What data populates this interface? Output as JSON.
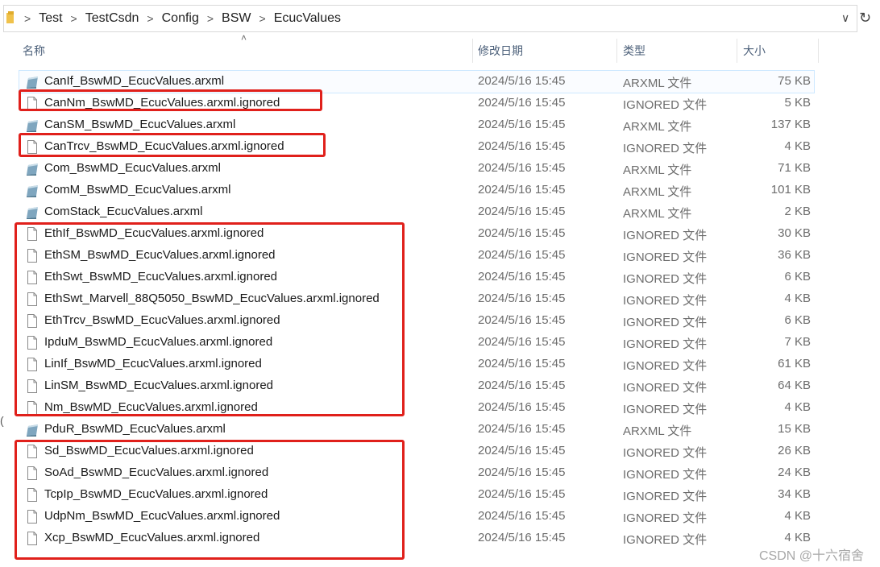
{
  "breadcrumb": [
    "Test",
    "TestCsdn",
    "Config",
    "BSW",
    "EcucValues"
  ],
  "columns": {
    "name": "名称",
    "date": "修改日期",
    "type": "类型",
    "size": "大小"
  },
  "files": [
    {
      "name": "CanIf_BswMD_EcucValues.arxml",
      "date": "2024/5/16 15:45",
      "type": "ARXML 文件",
      "size": "75 KB",
      "kind": "arxml",
      "selected": true
    },
    {
      "name": "CanNm_BswMD_EcucValues.arxml.ignored",
      "date": "2024/5/16 15:45",
      "type": "IGNORED 文件",
      "size": "5 KB",
      "kind": "ignored"
    },
    {
      "name": "CanSM_BswMD_EcucValues.arxml",
      "date": "2024/5/16 15:45",
      "type": "ARXML 文件",
      "size": "137 KB",
      "kind": "arxml"
    },
    {
      "name": "CanTrcv_BswMD_EcucValues.arxml.ignored",
      "date": "2024/5/16 15:45",
      "type": "IGNORED 文件",
      "size": "4 KB",
      "kind": "ignored"
    },
    {
      "name": "Com_BswMD_EcucValues.arxml",
      "date": "2024/5/16 15:45",
      "type": "ARXML 文件",
      "size": "71 KB",
      "kind": "arxml"
    },
    {
      "name": "ComM_BswMD_EcucValues.arxml",
      "date": "2024/5/16 15:45",
      "type": "ARXML 文件",
      "size": "101 KB",
      "kind": "arxml"
    },
    {
      "name": "ComStack_EcucValues.arxml",
      "date": "2024/5/16 15:45",
      "type": "ARXML 文件",
      "size": "2 KB",
      "kind": "arxml"
    },
    {
      "name": "EthIf_BswMD_EcucValues.arxml.ignored",
      "date": "2024/5/16 15:45",
      "type": "IGNORED 文件",
      "size": "30 KB",
      "kind": "ignored"
    },
    {
      "name": "EthSM_BswMD_EcucValues.arxml.ignored",
      "date": "2024/5/16 15:45",
      "type": "IGNORED 文件",
      "size": "36 KB",
      "kind": "ignored"
    },
    {
      "name": "EthSwt_BswMD_EcucValues.arxml.ignored",
      "date": "2024/5/16 15:45",
      "type": "IGNORED 文件",
      "size": "6 KB",
      "kind": "ignored"
    },
    {
      "name": "EthSwt_Marvell_88Q5050_BswMD_EcucValues.arxml.ignored",
      "date": "2024/5/16 15:45",
      "type": "IGNORED 文件",
      "size": "4 KB",
      "kind": "ignored"
    },
    {
      "name": "EthTrcv_BswMD_EcucValues.arxml.ignored",
      "date": "2024/5/16 15:45",
      "type": "IGNORED 文件",
      "size": "6 KB",
      "kind": "ignored"
    },
    {
      "name": "IpduM_BswMD_EcucValues.arxml.ignored",
      "date": "2024/5/16 15:45",
      "type": "IGNORED 文件",
      "size": "7 KB",
      "kind": "ignored"
    },
    {
      "name": "LinIf_BswMD_EcucValues.arxml.ignored",
      "date": "2024/5/16 15:45",
      "type": "IGNORED 文件",
      "size": "61 KB",
      "kind": "ignored"
    },
    {
      "name": "LinSM_BswMD_EcucValues.arxml.ignored",
      "date": "2024/5/16 15:45",
      "type": "IGNORED 文件",
      "size": "64 KB",
      "kind": "ignored"
    },
    {
      "name": "Nm_BswMD_EcucValues.arxml.ignored",
      "date": "2024/5/16 15:45",
      "type": "IGNORED 文件",
      "size": "4 KB",
      "kind": "ignored"
    },
    {
      "name": "PduR_BswMD_EcucValues.arxml",
      "date": "2024/5/16 15:45",
      "type": "ARXML 文件",
      "size": "15 KB",
      "kind": "arxml"
    },
    {
      "name": "Sd_BswMD_EcucValues.arxml.ignored",
      "date": "2024/5/16 15:45",
      "type": "IGNORED 文件",
      "size": "26 KB",
      "kind": "ignored"
    },
    {
      "name": "SoAd_BswMD_EcucValues.arxml.ignored",
      "date": "2024/5/16 15:45",
      "type": "IGNORED 文件",
      "size": "24 KB",
      "kind": "ignored"
    },
    {
      "name": "TcpIp_BswMD_EcucValues.arxml.ignored",
      "date": "2024/5/16 15:45",
      "type": "IGNORED 文件",
      "size": "34 KB",
      "kind": "ignored"
    },
    {
      "name": "UdpNm_BswMD_EcucValues.arxml.ignored",
      "date": "2024/5/16 15:45",
      "type": "IGNORED 文件",
      "size": "4 KB",
      "kind": "ignored"
    },
    {
      "name": "Xcp_BswMD_EcucValues.arxml.ignored",
      "date": "2024/5/16 15:45",
      "type": "IGNORED 文件",
      "size": "4 KB",
      "kind": "ignored"
    }
  ],
  "watermark": "CSDN @十六宿舍",
  "colors": {
    "highlight_box": "#e0201b",
    "header_text": "#4c607a",
    "selection_border": "#cde8ff"
  }
}
